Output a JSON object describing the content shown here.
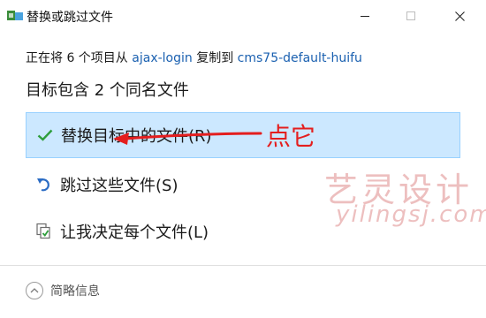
{
  "window": {
    "title": "替换或跳过文件",
    "icon": "move-copy-icon"
  },
  "copy_line": {
    "prefix": "正在将 6 个项目从 ",
    "source": "ajax-login",
    "middle": " 复制到 ",
    "destination": "cms75-default-huifu"
  },
  "heading": "目标包含 2 个同名文件",
  "options": [
    {
      "label": "替换目标中的文件(R)",
      "icon": "checkmark-icon",
      "selected": true
    },
    {
      "label": "跳过这些文件(S)",
      "icon": "skip-arrow-icon",
      "selected": false
    },
    {
      "label": "让我决定每个文件(L)",
      "icon": "decide-files-icon",
      "selected": false
    }
  ],
  "annotation": {
    "text": "点它",
    "color": "#e41e1e"
  },
  "watermark": {
    "cn": "艺灵设计",
    "en": "yilingsj.com"
  },
  "footer": {
    "details_label": "简略信息"
  },
  "colors": {
    "accent_link": "#1a60b0",
    "selection_bg": "#cce8ff",
    "selection_border": "#99d1ff",
    "check_green": "#2e9e3c"
  }
}
